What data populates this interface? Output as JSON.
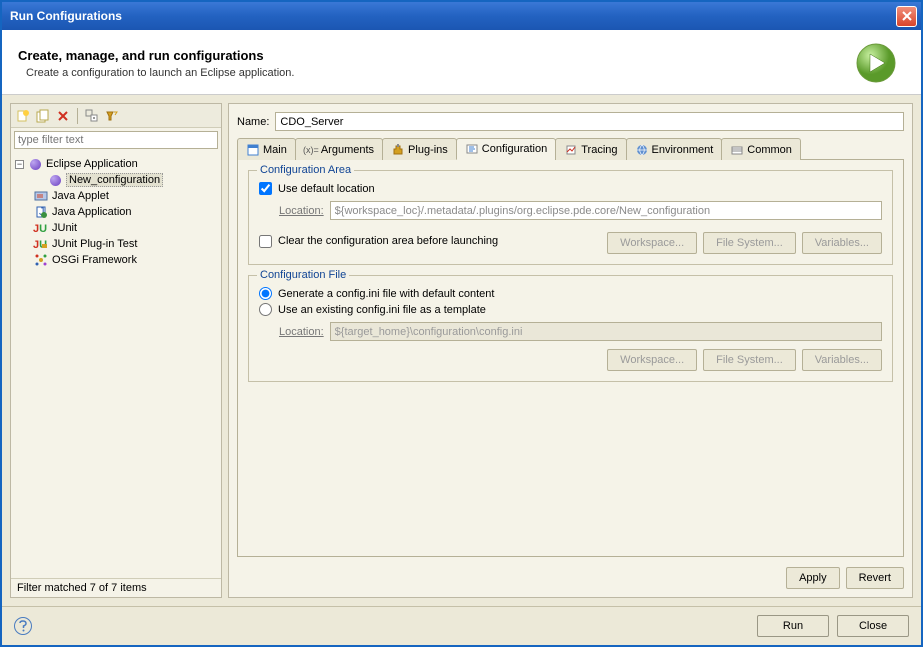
{
  "window": {
    "title": "Run Configurations"
  },
  "header": {
    "title": "Create, manage, and run configurations",
    "subtitle": "Create a configuration to launch an Eclipse application."
  },
  "left": {
    "filter_placeholder": "type filter text",
    "tree": {
      "root": "Eclipse Application",
      "child": "New_configuration",
      "items": [
        "Java Applet",
        "Java Application",
        "JUnit",
        "JUnit Plug-in Test",
        "OSGi Framework"
      ]
    },
    "status": "Filter matched 7 of 7 items"
  },
  "right": {
    "name_label": "Name:",
    "name_value": "CDO_Server",
    "tabs": [
      "Main",
      "Arguments",
      "Plug-ins",
      "Configuration",
      "Tracing",
      "Environment",
      "Common"
    ],
    "config_area": {
      "title": "Configuration Area",
      "use_default": "Use default location",
      "location_label": "Location:",
      "location_value": "${workspace_loc}/.metadata/.plugins/org.eclipse.pde.core/New_configuration",
      "clear": "Clear the configuration area before launching",
      "btn_workspace": "Workspace...",
      "btn_filesystem": "File System...",
      "btn_variables": "Variables..."
    },
    "config_file": {
      "title": "Configuration File",
      "generate": "Generate a config.ini file with default content",
      "existing": "Use an existing config.ini file as a template",
      "location_label": "Location:",
      "location_value": "${target_home}\\configuration\\config.ini",
      "btn_workspace": "Workspace...",
      "btn_filesystem": "File System...",
      "btn_variables": "Variables..."
    },
    "apply": "Apply",
    "revert": "Revert"
  },
  "footer": {
    "run": "Run",
    "close": "Close"
  }
}
